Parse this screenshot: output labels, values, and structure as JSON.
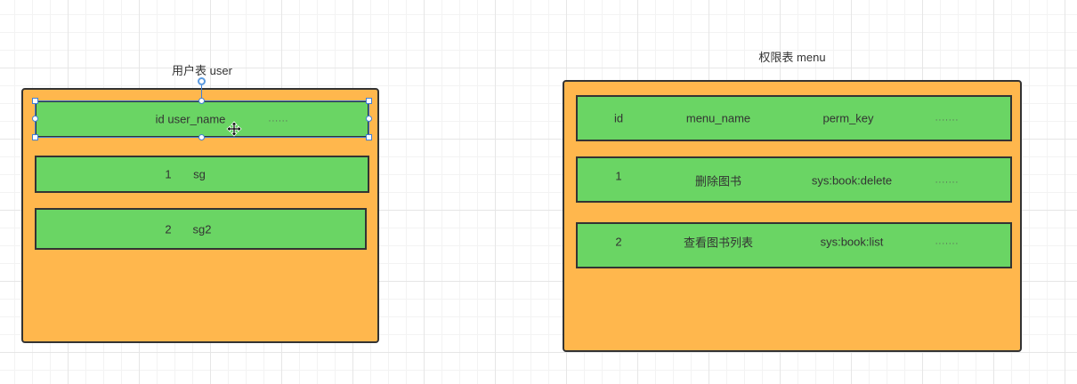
{
  "user_table": {
    "title": "用户表  user",
    "header": {
      "c1": "id user_name",
      "c2": "......"
    },
    "rows": [
      {
        "id": "1",
        "name": "sg"
      },
      {
        "id": "2",
        "name": "sg2"
      }
    ]
  },
  "menu_table": {
    "title": "权限表  menu",
    "header": {
      "c1": "id",
      "c2": "menu_name",
      "c3": "perm_key",
      "c4": "......."
    },
    "rows": [
      {
        "id": "1",
        "menu_name": "删除图书",
        "perm_key": "sys:book:delete",
        "more": "......."
      },
      {
        "id": "2",
        "menu_name": "查看图书列表",
        "perm_key": "sys:book:list",
        "more": "......."
      }
    ]
  },
  "colors": {
    "table_fill": "#ffb74d",
    "row_fill": "#6ad564",
    "border": "#333333",
    "selection": "#3f7fd6"
  },
  "icons": {
    "cursor": "move-cursor-icon"
  }
}
